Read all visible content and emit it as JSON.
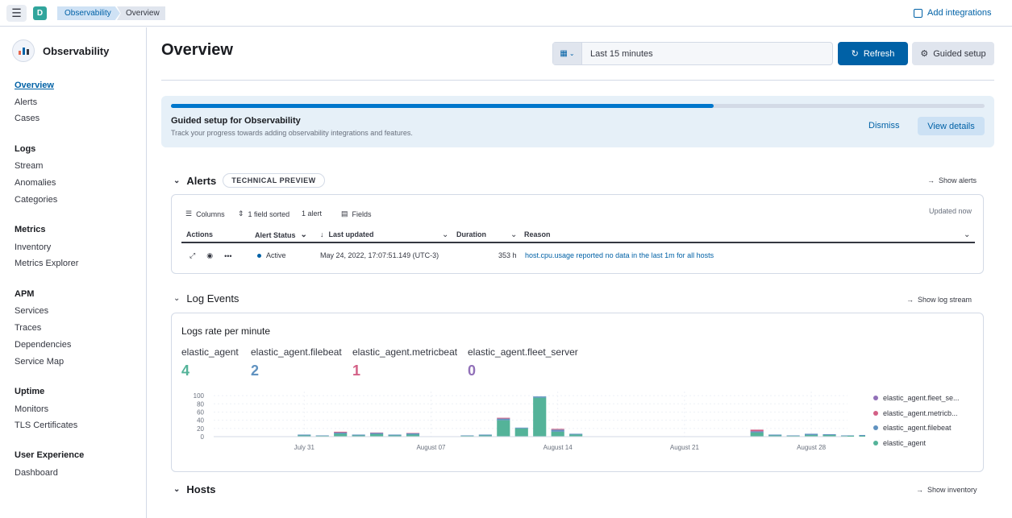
{
  "topbar": {
    "space_initial": "D",
    "breadcrumbs": [
      "Observability",
      "Overview"
    ],
    "add_integrations": "Add integrations"
  },
  "sidebar": {
    "title": "Observability",
    "sections": [
      {
        "heading": "",
        "items": [
          "Overview",
          "Alerts",
          "Cases"
        ]
      },
      {
        "heading": "Logs",
        "items": [
          "Stream",
          "Anomalies",
          "Categories"
        ]
      },
      {
        "heading": "Metrics",
        "items": [
          "Inventory",
          "Metrics Explorer"
        ]
      },
      {
        "heading": "APM",
        "items": [
          "Services",
          "Traces",
          "Dependencies",
          "Service Map"
        ]
      },
      {
        "heading": "Uptime",
        "items": [
          "Monitors",
          "TLS Certificates"
        ]
      },
      {
        "heading": "User Experience",
        "items": [
          "Dashboard"
        ]
      }
    ],
    "active": "Overview"
  },
  "header": {
    "title": "Overview",
    "date_range": "Last 15 minutes",
    "refresh_label": "Refresh",
    "guided_setup_label": "Guided setup"
  },
  "guided_setup": {
    "progress": 0.667,
    "title": "Guided setup for Observability",
    "subtitle": "Track your progress towards adding observability integrations and features.",
    "dismiss": "Dismiss",
    "view_details": "View details"
  },
  "alerts": {
    "title": "Alerts",
    "badge": "TECHNICAL PREVIEW",
    "show_link": "Show alerts",
    "toolbar": {
      "columns": "Columns",
      "sorted": "1 field sorted",
      "count": "1 alert",
      "fields": "Fields",
      "updated": "Updated now"
    },
    "columns": [
      "Actions",
      "Alert Status",
      "Last updated",
      "Duration",
      "Reason"
    ],
    "rows": [
      {
        "status": "Active",
        "last_updated": "May 24, 2022, 17:07:51.149 (UTC-3)",
        "duration": "353 h",
        "reason": "host.cpu.usage reported no data in the last 1m for all hosts"
      }
    ]
  },
  "log_events": {
    "title": "Log Events",
    "show_link": "Show log stream",
    "chart_title": "Logs rate per minute",
    "metrics": [
      {
        "label": "elastic_agent",
        "value": "4",
        "color": "#54b399"
      },
      {
        "label": "elastic_agent.filebeat",
        "value": "2",
        "color": "#6092c0"
      },
      {
        "label": "elastic_agent.metricbeat",
        "value": "1",
        "color": "#d36086"
      },
      {
        "label": "elastic_agent.fleet_server",
        "value": "0",
        "color": "#9170b8"
      }
    ],
    "legend": [
      {
        "label": "elastic_agent.fleet_se...",
        "color": "#9170b8"
      },
      {
        "label": "elastic_agent.metricb...",
        "color": "#d36086"
      },
      {
        "label": "elastic_agent.filebeat",
        "color": "#6092c0"
      },
      {
        "label": "elastic_agent",
        "color": "#54b399"
      }
    ]
  },
  "hosts": {
    "title": "Hosts",
    "show_link": "Show inventory"
  },
  "chart_data": {
    "type": "bar",
    "stacked": true,
    "x_ticks": [
      "July 31",
      "August 07",
      "August 14",
      "August 21",
      "August 28"
    ],
    "y_ticks": [
      "0",
      "20",
      "40",
      "60",
      "80",
      "100"
    ],
    "ylim": [
      0,
      110
    ],
    "x_range": [
      -5,
      30
    ],
    "series": [
      {
        "name": "elastic_agent",
        "color": "#54b399",
        "bars": [
          [
            0,
            3
          ],
          [
            1,
            2
          ],
          [
            2,
            7
          ],
          [
            3,
            3
          ],
          [
            4,
            6
          ],
          [
            5,
            3
          ],
          [
            6,
            5
          ],
          [
            9,
            2
          ],
          [
            10,
            3
          ],
          [
            11,
            40
          ],
          [
            12,
            20
          ],
          [
            13,
            95
          ],
          [
            14,
            12
          ],
          [
            15,
            5
          ],
          [
            25,
            10
          ],
          [
            26,
            3
          ],
          [
            27,
            2
          ],
          [
            28,
            4
          ],
          [
            29,
            4
          ],
          [
            30,
            2
          ],
          [
            31,
            2
          ],
          [
            32,
            3
          ],
          [
            33,
            2
          ],
          [
            34,
            2
          ]
        ]
      },
      {
        "name": "elastic_agent.filebeat",
        "color": "#6092c0",
        "bars": [
          [
            0,
            2
          ],
          [
            1,
            1
          ],
          [
            2,
            3
          ],
          [
            3,
            2
          ],
          [
            4,
            3
          ],
          [
            5,
            2
          ],
          [
            6,
            3
          ],
          [
            9,
            1
          ],
          [
            10,
            2
          ],
          [
            11,
            4
          ],
          [
            12,
            2
          ],
          [
            13,
            3
          ],
          [
            14,
            5
          ],
          [
            15,
            2
          ],
          [
            25,
            3
          ],
          [
            26,
            2
          ],
          [
            27,
            1
          ],
          [
            28,
            3
          ],
          [
            29,
            2
          ],
          [
            30,
            1
          ],
          [
            31,
            2
          ],
          [
            32,
            3
          ],
          [
            33,
            2
          ],
          [
            34,
            2
          ]
        ]
      },
      {
        "name": "elastic_agent.metricbeat",
        "color": "#d36086",
        "bars": [
          [
            2,
            2
          ],
          [
            4,
            1
          ],
          [
            6,
            1
          ],
          [
            11,
            2
          ],
          [
            14,
            2
          ],
          [
            25,
            4
          ]
        ]
      },
      {
        "name": "elastic_agent.fleet_server",
        "color": "#9170b8",
        "bars": []
      }
    ]
  }
}
